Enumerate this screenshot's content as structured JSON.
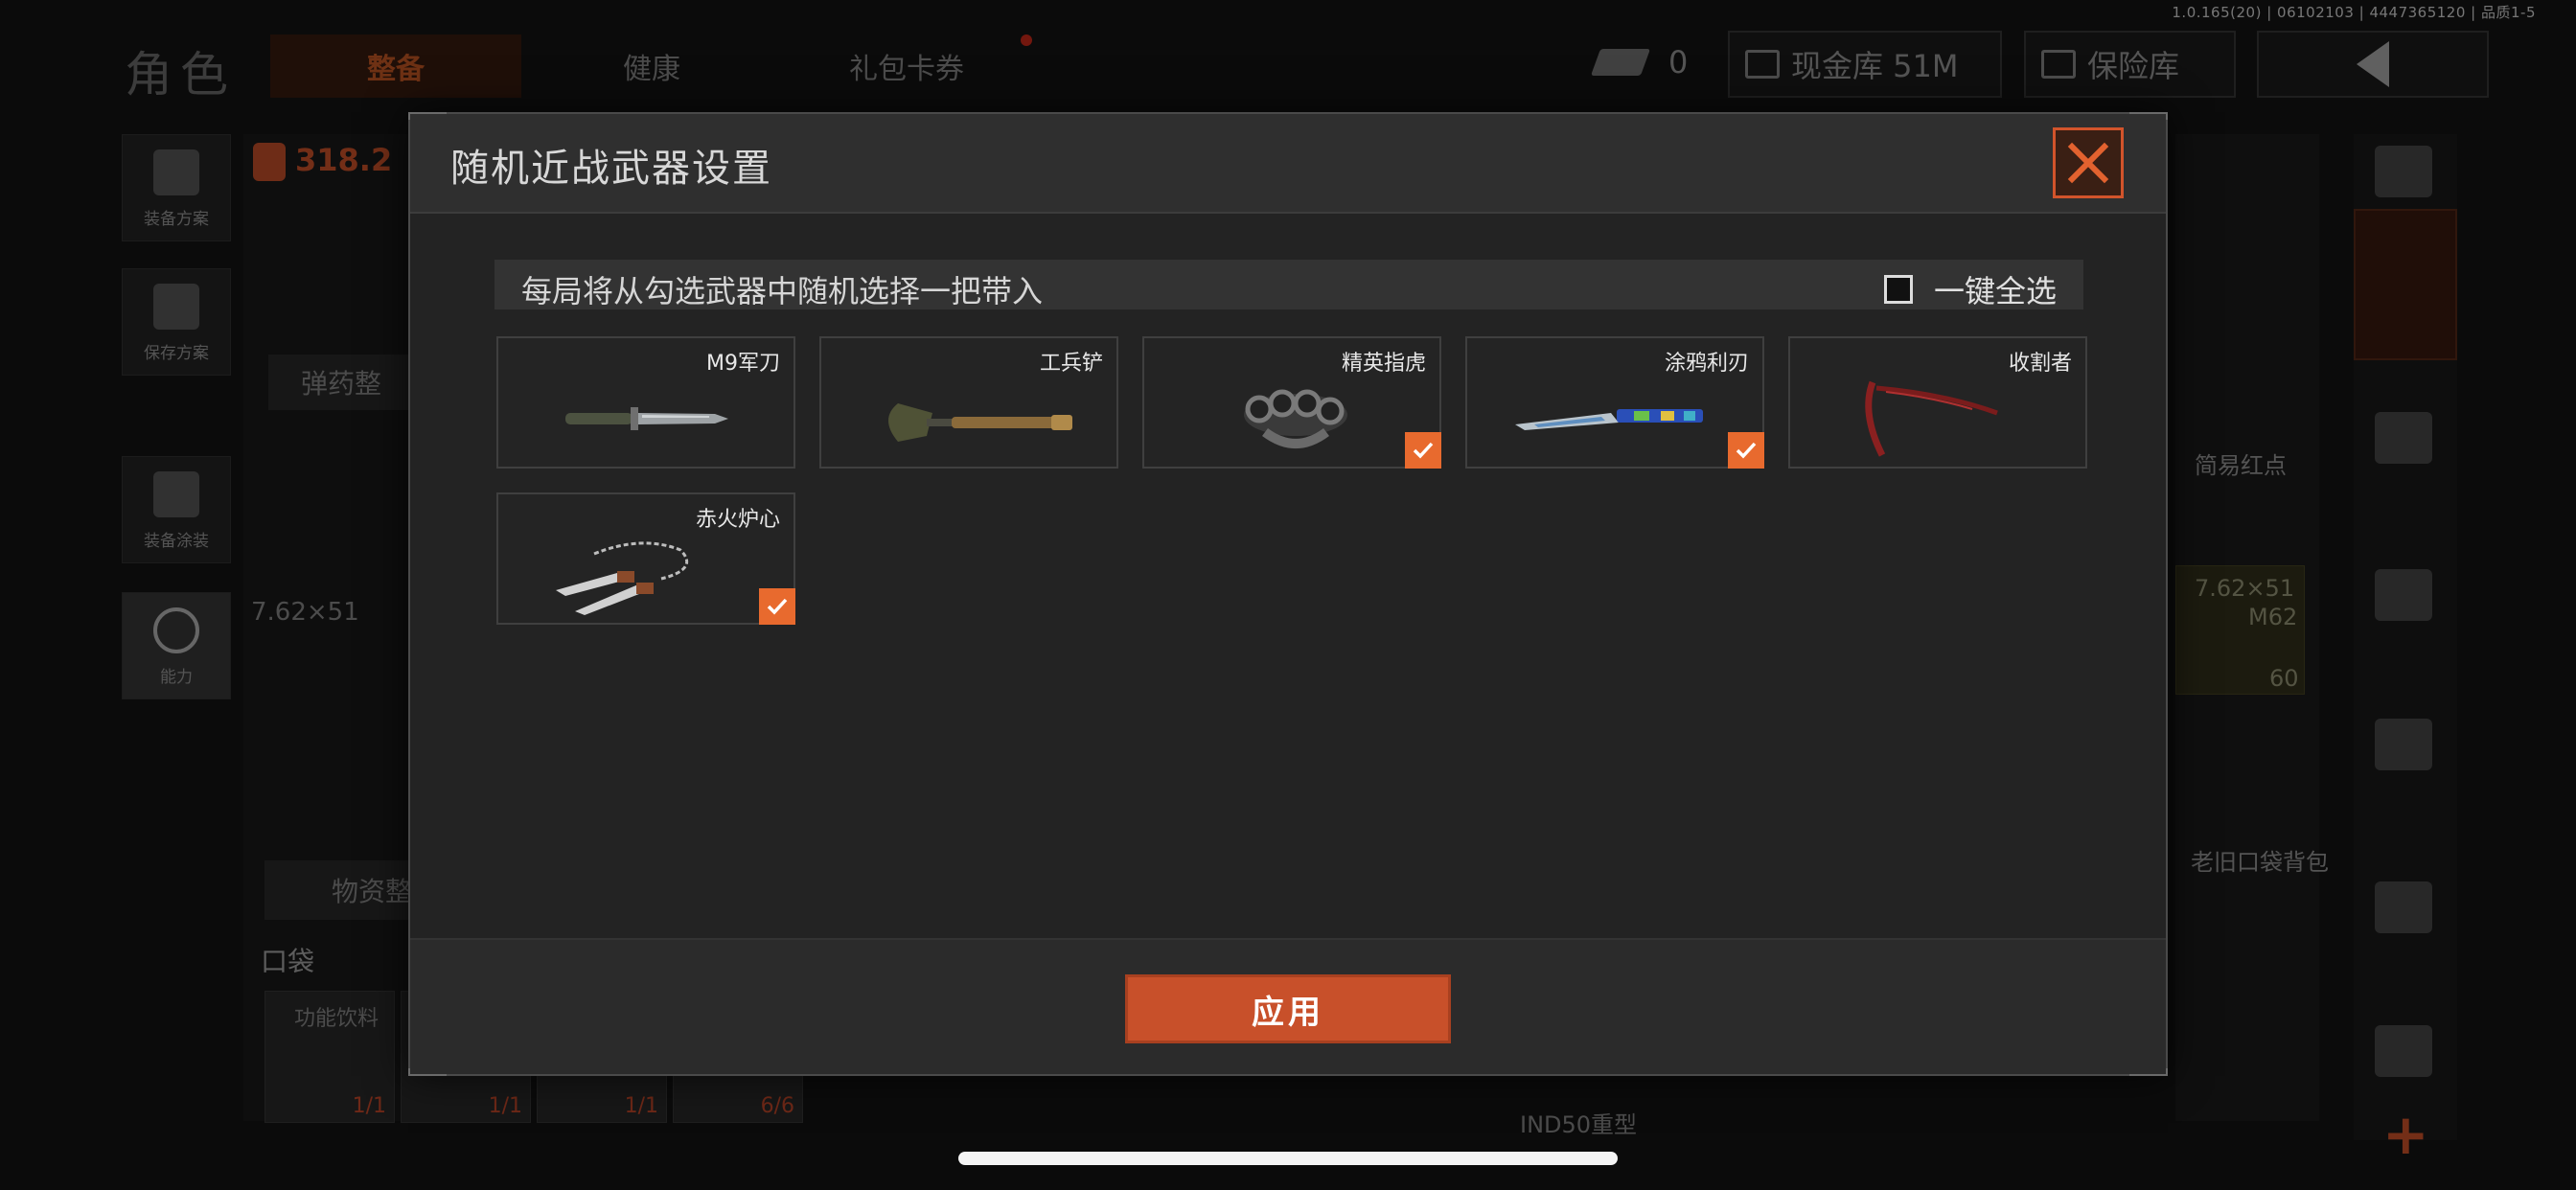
{
  "version_info": "1.0.165(20) | 06102103 | 4447365120 | 品质1-5",
  "background": {
    "page_title": "角色",
    "tabs": [
      {
        "label": "整备",
        "active": true
      },
      {
        "label": "健康",
        "active": false
      },
      {
        "label": "礼包卡券",
        "active": false
      }
    ],
    "coin_count": "0",
    "cash_vault": "现金库 51M",
    "safe_box": "保险库",
    "side_buttons": [
      "装备方案",
      "保存方案",
      "装备涂装",
      "能力"
    ],
    "capacity_value": "318.2",
    "ammo_button": "弹药整",
    "ammo_caliber": "7.62×51",
    "supply_button": "物资整",
    "pocket_label": "口袋",
    "pocket_slots": [
      {
        "name": "功能饮料",
        "count": "1/1"
      },
      {
        "name": "",
        "count": "1/1"
      },
      {
        "name": "",
        "count": "1/1"
      },
      {
        "name": "",
        "count": "6/6"
      }
    ],
    "right_panel": {
      "sight_label": "简易红点",
      "ammo_caliber": "7.62×51",
      "ammo_type": "M62",
      "ammo_count": "60",
      "bag_label": "老旧口袋背包",
      "bottom_item": "IND50重型"
    }
  },
  "modal": {
    "title": "随机近战武器设置",
    "info_text": "每局将从勾选武器中随机选择一把带入",
    "select_all_label": "一键全选",
    "select_all_checked": false,
    "apply_label": "应用",
    "accent_color": "#e86a2e",
    "weapons": [
      {
        "name": "M9军刀",
        "checked": false,
        "icon": "bayonet-knife"
      },
      {
        "name": "工兵铲",
        "checked": false,
        "icon": "shovel"
      },
      {
        "name": "精英指虎",
        "checked": true,
        "icon": "brass-knuckles"
      },
      {
        "name": "涂鸦利刃",
        "checked": true,
        "icon": "graffiti-blade"
      },
      {
        "name": "收割者",
        "checked": false,
        "icon": "reaper-scythe"
      },
      {
        "name": "赤火炉心",
        "checked": true,
        "icon": "chained-blades"
      }
    ]
  }
}
